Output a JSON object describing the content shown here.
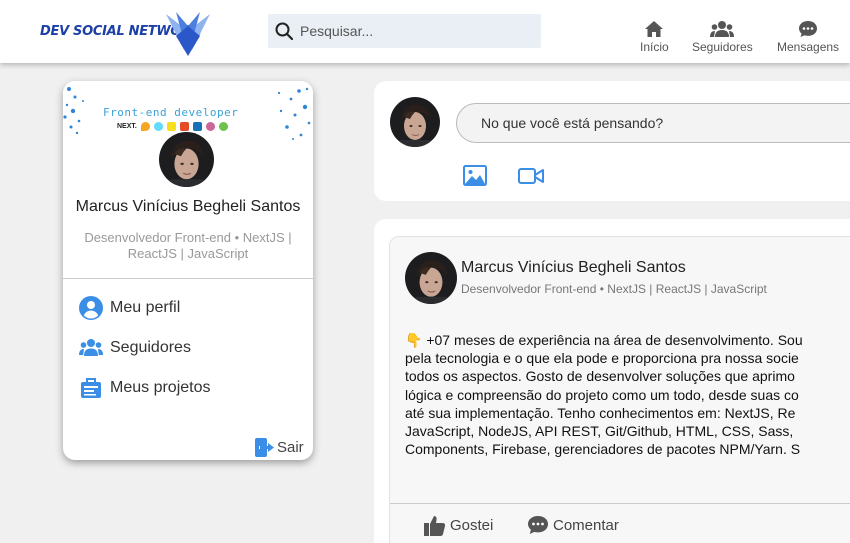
{
  "header": {
    "logo_text": "DEV SOCIAL NETWORK",
    "search_placeholder": "Pesquisar...",
    "nav": [
      {
        "label": "Início",
        "icon": "home-icon"
      },
      {
        "label": "Seguidores",
        "icon": "users-icon"
      },
      {
        "label": "Mensagens",
        "icon": "chat-icon"
      }
    ]
  },
  "profile_card": {
    "banner_title": "Front-end developer",
    "banner_badge": "NEXT.",
    "name": "Marcus Vinícius Begheli Santos",
    "role": "Desenvolvedor Front-end • NextJS | ReactJS | JavaScript",
    "menu": [
      {
        "label": "Meu perfil",
        "icon": "user-circle-icon"
      },
      {
        "label": "Seguidores",
        "icon": "users-icon"
      },
      {
        "label": "Meus projetos",
        "icon": "projects-icon"
      }
    ],
    "logout_label": "Sair"
  },
  "composer": {
    "placeholder": "No que você está pensando?",
    "actions": [
      "image-icon",
      "video-icon"
    ]
  },
  "post": {
    "author_name": "Marcus Vinícius Begheli Santos",
    "author_role": "Desenvolvedor Front-end • NextJS | ReactJS | JavaScript",
    "emoji": "👇",
    "text_lines": [
      "+07 meses de experiência na área de desenvolvimento. Sou",
      "pela tecnologia e o que ela pode e proporciona pra nossa socie",
      "todos os aspectos. Gosto de desenvolver soluções que aprimo",
      "lógica e compreensão do projeto como um todo, desde suas co",
      "até sua implementação. Tenho conhecimentos em: NextJS, Re",
      "JavaScript, NodeJS, API REST, Git/Github, HTML, CSS, Sass,",
      "Components, Firebase, gerenciadores de pacotes NPM/Yarn. S"
    ],
    "like_label": "Gostei",
    "comment_label": "Comentar"
  },
  "colors": {
    "brand": "#1b3fa6",
    "accent": "#3a8ee6",
    "page_bg": "#f0f0f0"
  }
}
